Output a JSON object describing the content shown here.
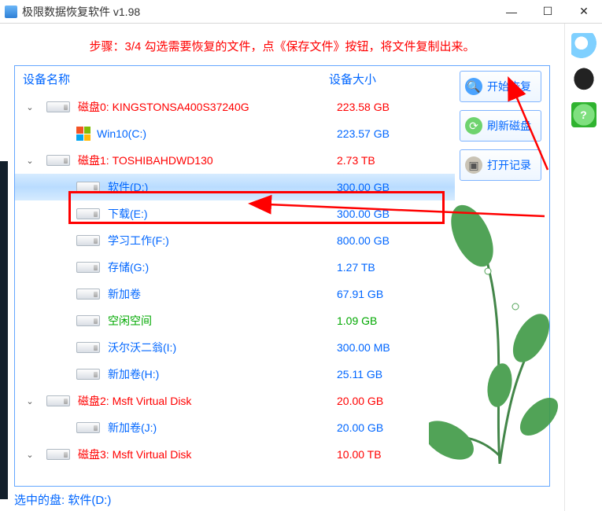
{
  "window": {
    "title": "极限数据恢复软件 v1.98"
  },
  "step_info": "步骤：3/4 勾选需要恢复的文件，点《保存文件》按钮，将文件复制出来。",
  "headers": {
    "name": "设备名称",
    "size": "设备大小"
  },
  "actions": {
    "start": "开始恢复",
    "refresh": "刷新磁盘",
    "open_log": "打开记录"
  },
  "footer": "选中的盘: 软件(D:)",
  "tree": [
    {
      "depth": 0,
      "expander": "v",
      "icon": "disk",
      "label": "磁盘0: KINGSTONSA400S37240G",
      "size": "223.58 GB",
      "cls": "disk-top"
    },
    {
      "depth": 1,
      "expander": "",
      "icon": "win",
      "label": "Win10(C:)",
      "size": "223.57 GB",
      "cls": "sub"
    },
    {
      "depth": 0,
      "expander": "v",
      "icon": "disk",
      "label": "磁盘1: TOSHIBAHDWD130",
      "size": "2.73 TB",
      "cls": "disk-top"
    },
    {
      "depth": 1,
      "expander": "",
      "icon": "disk",
      "label": "软件(D:)",
      "size": "300.00 GB",
      "cls": "sub",
      "selected": true
    },
    {
      "depth": 1,
      "expander": "",
      "icon": "disk",
      "label": "下载(E:)",
      "size": "300.00 GB",
      "cls": "sub"
    },
    {
      "depth": 1,
      "expander": "",
      "icon": "disk",
      "label": "学习工作(F:)",
      "size": "800.00 GB",
      "cls": "sub"
    },
    {
      "depth": 1,
      "expander": "",
      "icon": "disk",
      "label": "存储(G:)",
      "size": "1.27 TB",
      "cls": "sub"
    },
    {
      "depth": 1,
      "expander": "",
      "icon": "disk",
      "label": "新加卷",
      "size": "67.91 GB",
      "cls": "sub"
    },
    {
      "depth": 1,
      "expander": "",
      "icon": "disk",
      "label": "空闲空间",
      "size": "1.09 GB",
      "cls": "green"
    },
    {
      "depth": 1,
      "expander": "",
      "icon": "disk",
      "label": "沃尔沃二翁(I:)",
      "size": "300.00 MB",
      "cls": "sub"
    },
    {
      "depth": 1,
      "expander": "",
      "icon": "disk",
      "label": "新加卷(H:)",
      "size": "25.11 GB",
      "cls": "sub"
    },
    {
      "depth": 0,
      "expander": "v",
      "icon": "disk",
      "label": "磁盘2: Msft     Virtual Disk",
      "size": "20.00 GB",
      "cls": "disk-top"
    },
    {
      "depth": 1,
      "expander": "",
      "icon": "disk",
      "label": "新加卷(J:)",
      "size": "20.00 GB",
      "cls": "sub"
    },
    {
      "depth": 0,
      "expander": "v",
      "icon": "disk",
      "label": "磁盘3: Msft     Virtual Disk",
      "size": "10.00 TB",
      "cls": "disk-top"
    }
  ]
}
